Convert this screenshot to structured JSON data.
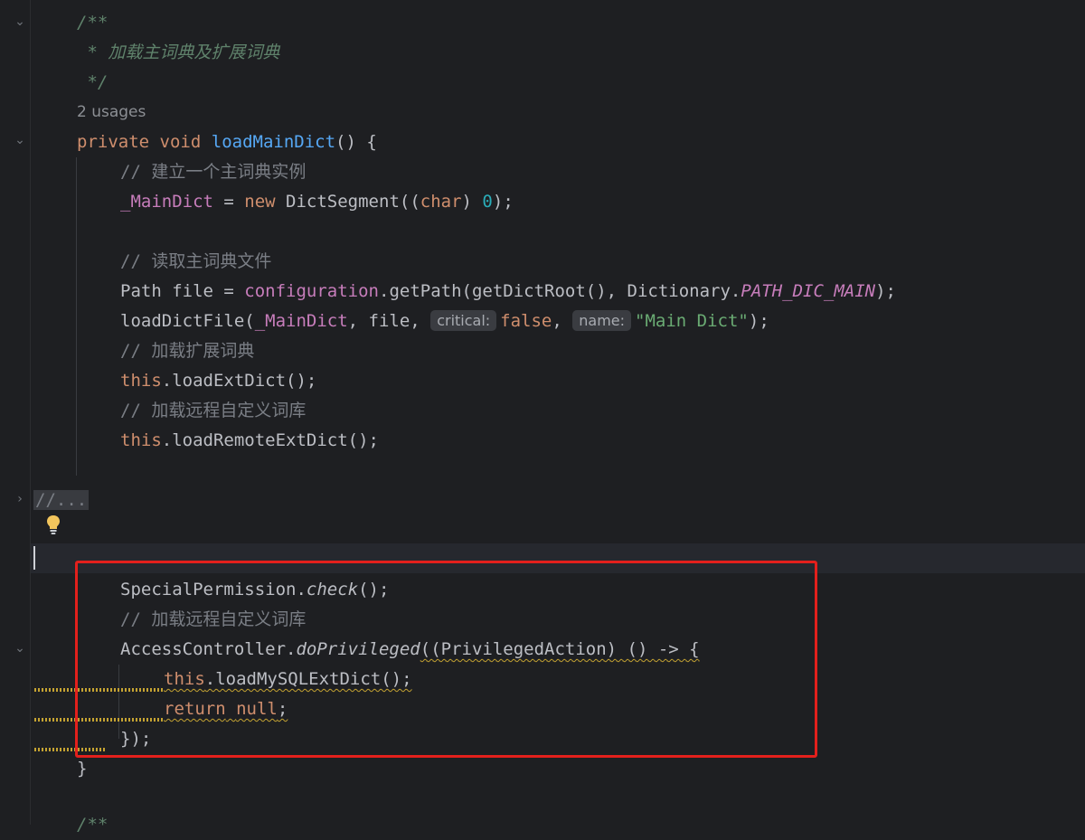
{
  "editor": {
    "lines": {
      "doc_open": "/**",
      "doc_text": " * 加载主词典及扩展词典",
      "doc_close": " */",
      "usages": "2 usages",
      "sig_private": "private",
      "sig_void": "void",
      "sig_name": "loadMainDict",
      "sig_rest": "() {",
      "c1": "// 建立一个主词典实例",
      "l2_field": "_MainDict",
      "l2_eq": " = ",
      "l2_new": "new",
      "l2_rest1": " DictSegment((",
      "l2_char": "char",
      "l2_rest2": ") ",
      "l2_num": "0",
      "l2_end": ");",
      "c2": "// 读取主词典文件",
      "l3_a": "Path file = ",
      "l3_cfg": "configuration",
      "l3_b": ".getPath(getDictRoot(), Dictionary.",
      "l3_const": "PATH_DIC_MAIN",
      "l3_end": ");",
      "l4_a": "loadDictFile(",
      "l4_field": "_MainDict",
      "l4_b": ", file, ",
      "l4_hint1": "critical:",
      "l4_false": "false",
      "l4_c": ", ",
      "l4_hint2": "name:",
      "l4_str": "\"Main Dict\"",
      "l4_end": ");",
      "c3": "// 加载扩展词典",
      "l5_this": "this",
      "l5_rest": ".loadExtDict();",
      "c4": "// 加载远程自定义词库",
      "l6_this": "this",
      "l6_rest": ".loadRemoteExtDict();",
      "folded": "//...",
      "l7_a": "SpecialPermission.",
      "l7_check": "check",
      "l7_end": "();",
      "c5": "// 加载远程自定义词库",
      "l8_a": "AccessController.",
      "l8_priv": "doPrivileged",
      "l8_b": "((PrivilegedAction) () -> {",
      "l9_this": "this",
      "l9_rest": ".loadMySQLExtDict();",
      "l10_return": "return",
      "l10_null": "null",
      "l10_end": ";",
      "l11": "});",
      "l12": "}",
      "l13": "/**"
    }
  },
  "colors": {
    "background": "#1e1f22",
    "keyword": "#cf8e6d",
    "function": "#56a8f5",
    "field": "#c77dbb",
    "string": "#6aab73",
    "number": "#2aacb8",
    "comment": "#7a7e85",
    "highlight_box": "#e3201c"
  }
}
